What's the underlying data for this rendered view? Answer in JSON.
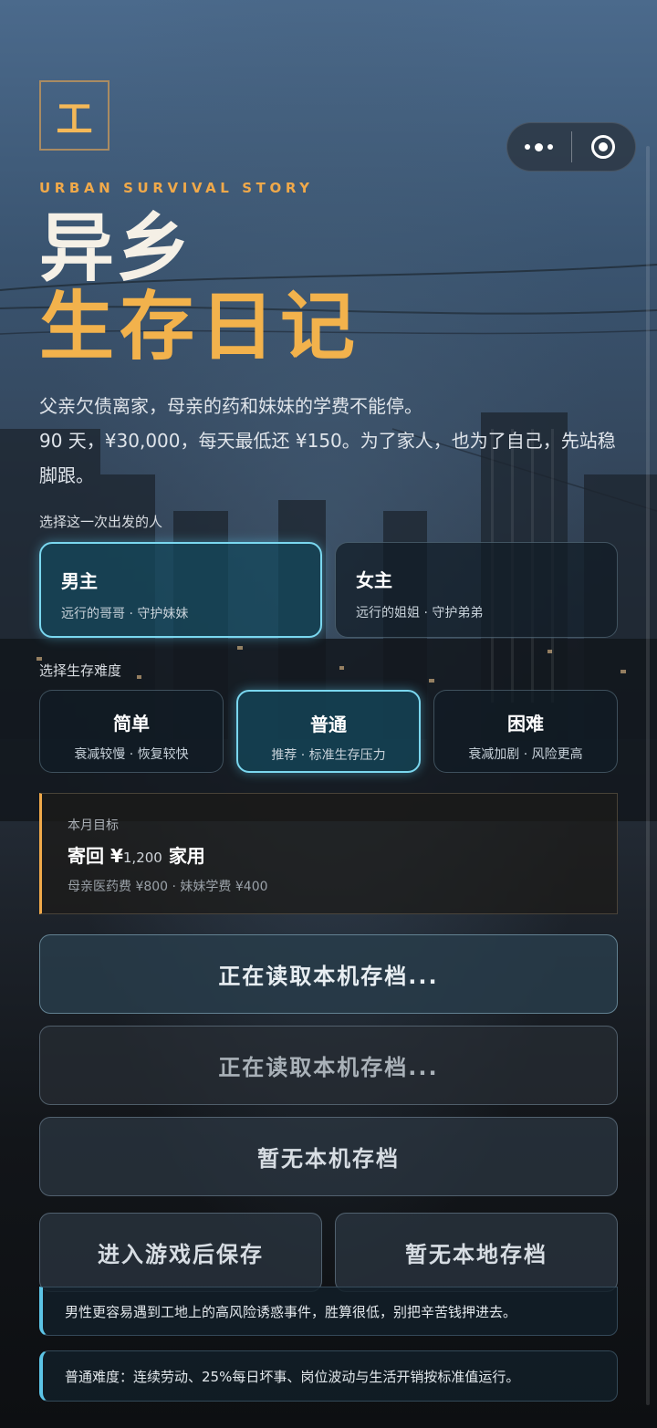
{
  "logo": {
    "glyph": "工"
  },
  "capsule": {
    "more_icon": "more-dots-icon",
    "close_icon": "target-ring-icon"
  },
  "header": {
    "subtitle_en": "URBAN SURVIVAL STORY",
    "title_line1": "异乡",
    "title_line2": "生存日记"
  },
  "intro": {
    "line1": "父亲欠债离家，母亲的药和妹妹的学费不能停。",
    "line2": "90 天，¥30,000，每天最低还 ¥150。为了家人，也为了自己，先站稳脚跟。"
  },
  "character": {
    "label": "选择这一次出发的人",
    "options": [
      {
        "title": "男主",
        "desc": "远行的哥哥 · 守护妹妹",
        "selected": true
      },
      {
        "title": "女主",
        "desc": "远行的姐姐 · 守护弟弟",
        "selected": false
      }
    ]
  },
  "difficulty": {
    "label": "选择生存难度",
    "options": [
      {
        "title": "简单",
        "desc": "衰减较慢 · 恢复较快",
        "selected": false
      },
      {
        "title": "普通",
        "desc": "推荐 · 标准生存压力",
        "selected": true
      },
      {
        "title": "困难",
        "desc": "衰减加剧 · 风险更高",
        "selected": false
      }
    ]
  },
  "goal": {
    "label": "本月目标",
    "prefix": "寄回",
    "currency": "¥",
    "amount": "1,200",
    "suffix": "家用",
    "detail": "母亲医药费 ¥800 · 妹妹学费 ¥400"
  },
  "buttons": {
    "load_primary": "正在读取本机存档...",
    "load_secondary": "正在读取本机存档...",
    "no_local_save": "暂无本机存档",
    "save_after_enter": "进入游戏后保存",
    "no_local_archive": "暂无本地存档"
  },
  "tips": {
    "character_tip": "男性更容易遇到工地上的高风险诱惑事件，胜算很低，别把辛苦钱押进去。",
    "difficulty_tip": "普通难度：连续劳动、25%每日坏事、岗位波动与生活开销按标准值运行。"
  },
  "colors": {
    "accent_orange": "#f2b24c",
    "accent_cyan": "#7ad7ef",
    "title_white": "#f5f0e6"
  }
}
